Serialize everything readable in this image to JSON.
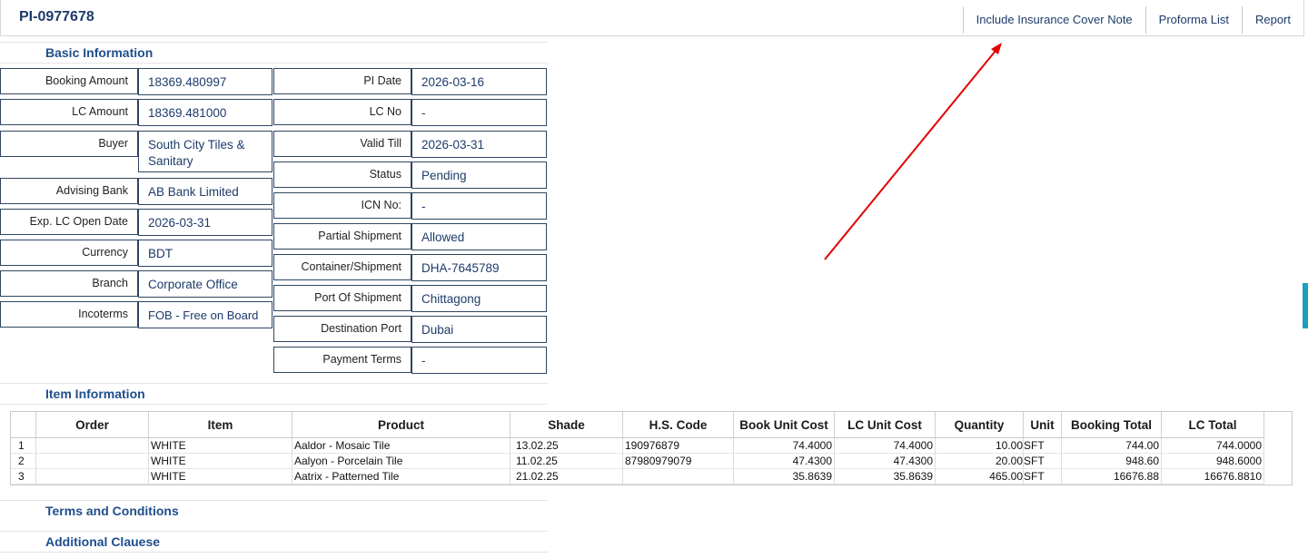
{
  "header": {
    "pi_number": "PI-0977678",
    "links": [
      "Include Insurance Cover Note",
      "Proforma List",
      "Report"
    ]
  },
  "sections": {
    "basic": "Basic Information",
    "items": "Item Information",
    "terms": "Terms and Conditions",
    "clauses": "Additional Clauese"
  },
  "left_fields": [
    {
      "label": "Booking Amount",
      "value": "18369.480997"
    },
    {
      "label": "LC Amount",
      "value": "18369.481000"
    },
    {
      "label": "Buyer",
      "value": "South City Tiles & Sanitary"
    },
    {
      "label": "Advising Bank",
      "value": "AB Bank Limited"
    },
    {
      "label": "Exp. LC Open Date",
      "value": "2026-03-31"
    },
    {
      "label": "Currency",
      "value": "BDT"
    },
    {
      "label": "Branch",
      "value": "Corporate Office"
    },
    {
      "label": "Incoterms",
      "value": "FOB - Free on Board"
    }
  ],
  "right_fields": [
    {
      "label": "PI Date",
      "value": "2026-03-16"
    },
    {
      "label": "LC No",
      "value": "-"
    },
    {
      "label": "Valid Till",
      "value": "2026-03-31"
    },
    {
      "label": "Status",
      "value": "Pending"
    },
    {
      "label": "ICN No:",
      "value": "-"
    },
    {
      "label": "Partial Shipment",
      "value": "Allowed"
    },
    {
      "label": "Container/Shipment",
      "value": "DHA-7645789"
    },
    {
      "label": "Port Of Shipment",
      "value": "Chittagong"
    },
    {
      "label": "Destination Port",
      "value": "Dubai"
    },
    {
      "label": "Payment Terms",
      "value": "-"
    }
  ],
  "item_table": {
    "columns": [
      "",
      "Order",
      "Item",
      "Product",
      "Shade",
      "H.S. Code",
      "Book Unit Cost",
      "LC Unit Cost",
      "Quantity",
      "Unit",
      "Booking Total",
      "LC Total"
    ],
    "rows": [
      [
        "1",
        "",
        "WHITE",
        "Aaldor - Mosaic Tile",
        "13.02.25",
        "190976879",
        "74.4000",
        "74.4000",
        "10.00",
        "SFT",
        "744.00",
        "744.0000"
      ],
      [
        "2",
        "",
        "WHITE",
        "Aalyon - Porcelain Tile",
        "11.02.25",
        "87980979079",
        "47.4300",
        "47.4300",
        "20.00",
        "SFT",
        "948.60",
        "948.6000"
      ],
      [
        "3",
        "",
        "WHITE",
        "Aatrix - Patterned Tile",
        "21.02.25",
        "",
        "35.8639",
        "35.8639",
        "465.00",
        "SFT",
        "16676.88",
        "16676.8810"
      ]
    ]
  },
  "colors": {
    "title_blue": "#1d3b6a",
    "section_blue": "#1f4e8c",
    "annotation_arrow": "#e00000"
  }
}
